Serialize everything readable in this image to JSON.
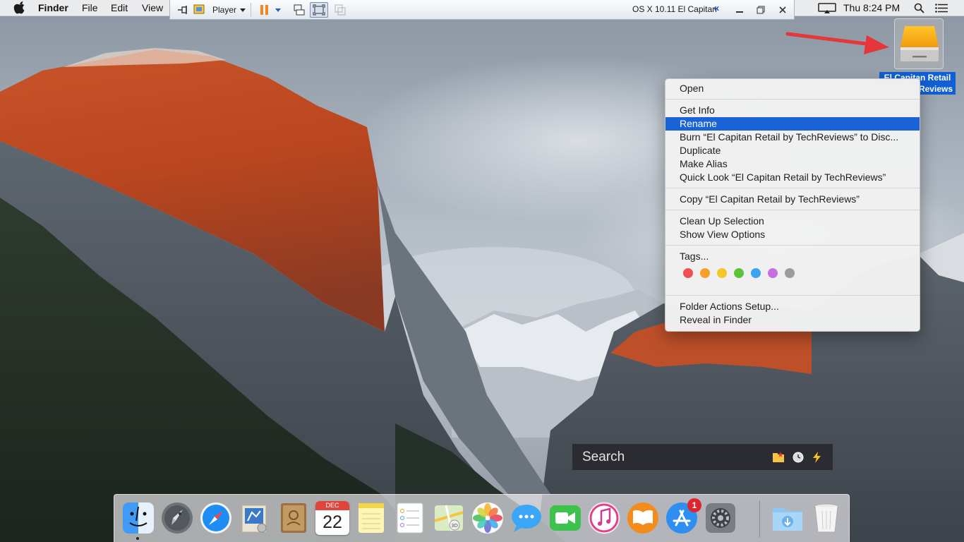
{
  "menubar": {
    "app_name": "Finder",
    "items": [
      "File",
      "Edit",
      "View"
    ],
    "clock": "Thu 8:24 PM"
  },
  "player_toolbar": {
    "player_label": "Player",
    "vm_name": "OS X 10.11 El Capitan",
    "collapse_glyph": "«"
  },
  "desktop_icon": {
    "name_line1": "El Capitan Retail",
    "name_line2": "Reviews",
    "icon": "external-drive-icon"
  },
  "context_menu": {
    "items": [
      "Open",
      "Get Info",
      "Rename",
      "Burn “El Capitan Retail by TechReviews” to Disc...",
      "Duplicate",
      "Make Alias",
      "Quick Look “El Capitan Retail by TechReviews”",
      "Copy “El Capitan Retail by TechReviews”",
      "Clean Up Selection",
      "Show View Options",
      "Tags...",
      "Folder Actions Setup...",
      "Reveal in Finder"
    ],
    "highlighted": "Rename",
    "tag_colors": [
      {
        "name": "red",
        "hex": "#f05153"
      },
      {
        "name": "orange",
        "hex": "#f5a027"
      },
      {
        "name": "yellow",
        "hex": "#f3c828"
      },
      {
        "name": "green",
        "hex": "#5ec13d"
      },
      {
        "name": "blue",
        "hex": "#3aa3f2"
      },
      {
        "name": "purple",
        "hex": "#c56fe0"
      },
      {
        "name": "gray",
        "hex": "#9c9c9c"
      }
    ]
  },
  "search": {
    "placeholder": "Search"
  },
  "dock": {
    "apps": [
      "finder-icon",
      "launchpad-icon",
      "safari-icon",
      "mail-icon",
      "contacts-icon",
      "calendar-icon",
      "notes-icon",
      "reminders-icon",
      "maps-icon",
      "photos-icon",
      "messages-icon",
      "facetime-icon",
      "itunes-icon",
      "ibooks-icon",
      "app-store-icon",
      "system-preferences-icon",
      "downloads-folder-icon",
      "trash-icon"
    ],
    "calendar_month": "DEC",
    "calendar_day": "22",
    "app_store_badge": "1"
  },
  "colors": {
    "highlight": "#1a63d6",
    "arrow": "#e5363c"
  }
}
